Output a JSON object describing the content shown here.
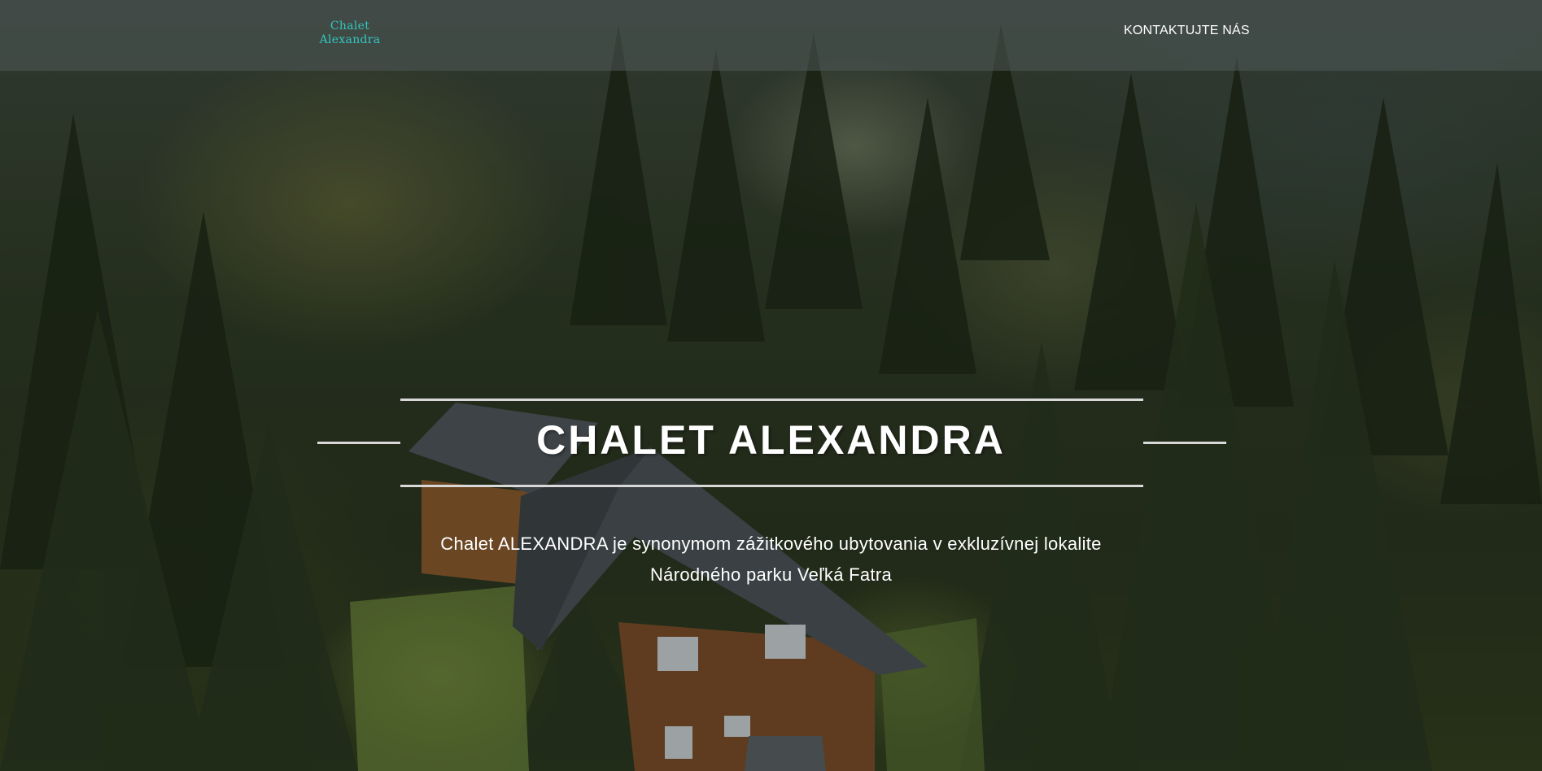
{
  "header": {
    "logo_line1": "Chalet",
    "logo_line2": "Alexandra",
    "contact_link": "KONTAKTUJTE NÁS"
  },
  "hero": {
    "title": "CHALET ALEXANDRA",
    "subtitle_line1": "Chalet ALEXANDRA je synonymom zážitkového ubytovania v exkluzívnej lokalite",
    "subtitle_line2": "Národného parku Veľká Fatra"
  },
  "colors": {
    "logo": "#34c6c0",
    "text": "#ffffff",
    "divider": "#d8d8d8"
  }
}
